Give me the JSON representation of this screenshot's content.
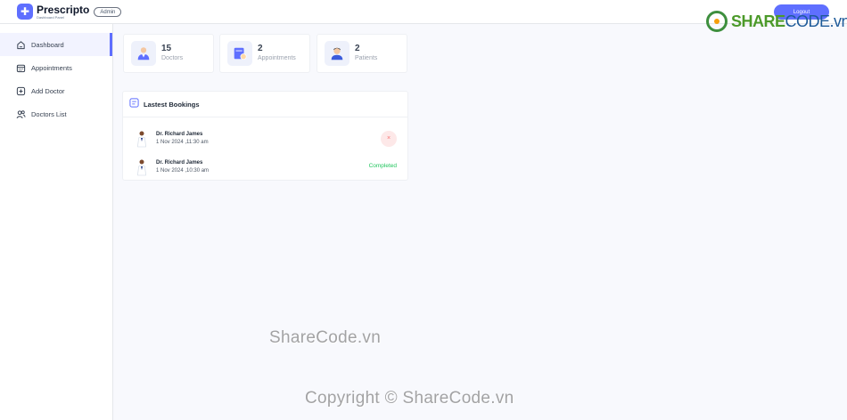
{
  "header": {
    "brand_name": "Prescripto",
    "brand_sub": "Dashboard Panel",
    "role_badge": "Admin",
    "logout_label": "Logout"
  },
  "watermark": {
    "logo_text_a": "SHARE",
    "logo_text_b": "CODE.vn",
    "mid_text": "ShareCode.vn",
    "bottom_text": "Copyright © ShareCode.vn"
  },
  "sidebar": {
    "items": [
      {
        "label": "Dashboard",
        "icon": "home-icon",
        "active": true
      },
      {
        "label": "Appointments",
        "icon": "calendar-icon",
        "active": false
      },
      {
        "label": "Add Doctor",
        "icon": "add-icon",
        "active": false
      },
      {
        "label": "Doctors List",
        "icon": "people-icon",
        "active": false
      }
    ]
  },
  "stats": [
    {
      "value": "15",
      "label": "Doctors",
      "icon": "doctor-icon"
    },
    {
      "value": "2",
      "label": "Appointments",
      "icon": "appointment-icon"
    },
    {
      "value": "2",
      "label": "Patients",
      "icon": "patient-icon"
    }
  ],
  "bookings": {
    "title": "Lastest Bookings",
    "rows": [
      {
        "doctor": "Dr. Richard James",
        "date": "1 Nov 2024 ,11:30 am",
        "status": "cancel",
        "status_label": "×"
      },
      {
        "doctor": "Dr. Richard James",
        "date": "1 Nov 2024 ,10:30 am",
        "status": "completed",
        "status_label": "Completed"
      }
    ]
  },
  "colors": {
    "primary": "#5f6fff",
    "completed": "#22c55e",
    "cancel": "#f87171"
  }
}
